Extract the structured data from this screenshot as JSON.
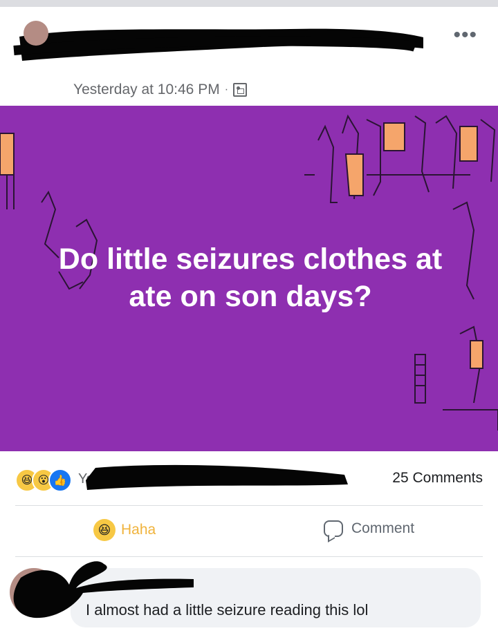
{
  "post": {
    "timestamp": "Yesterday at 10:46 PM",
    "separator": "·",
    "more_icon": "ellipsis-icon",
    "audience_icon": "friends-audience-icon"
  },
  "banner": {
    "background": "#8e2fb0",
    "text": "Do little seizures clothes at ate on son days?"
  },
  "reactions": {
    "icons": [
      "haha-icon",
      "wow-icon",
      "like-icon"
    ],
    "label_visible": "Yo",
    "comments": "25 Comments"
  },
  "actions": {
    "haha": "Haha",
    "comment": "Comment"
  },
  "comment": {
    "text": "I almost had a little seizure reading this lol"
  }
}
